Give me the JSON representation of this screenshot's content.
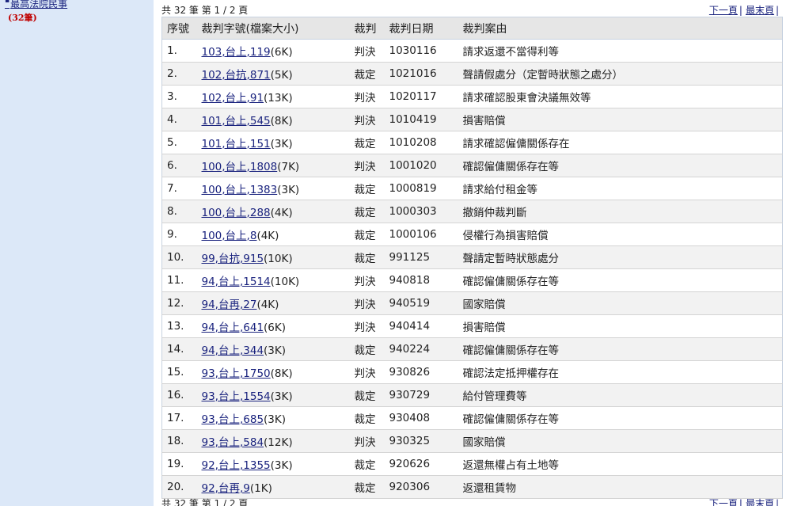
{
  "sidebar": {
    "court_link": "最高法院民事",
    "court_count": "(32筆)"
  },
  "pager": {
    "count_text": "共 32 筆 第 1 / 2 頁",
    "next_label": "下一頁",
    "last_label": "最末頁"
  },
  "table": {
    "headers": {
      "no": "序號",
      "case": "裁判字號(檔案大小)",
      "type": "裁判",
      "date": "裁判日期",
      "reason": "裁判案由"
    },
    "rows": [
      {
        "no": "1.",
        "case": "103,台上,119",
        "size": "(6K)",
        "type": "判決",
        "date": "1030116",
        "reason": "請求返還不當得利等"
      },
      {
        "no": "2.",
        "case": "102,台抗,871",
        "size": "(5K)",
        "type": "裁定",
        "date": "1021016",
        "reason": "聲請假處分（定暫時狀態之處分）"
      },
      {
        "no": "3.",
        "case": "102,台上,91",
        "size": "(13K)",
        "type": "判決",
        "date": "1020117",
        "reason": "請求確認股東會決議無效等"
      },
      {
        "no": "4.",
        "case": "101,台上,545",
        "size": "(8K)",
        "type": "判決",
        "date": "1010419",
        "reason": "損害賠償"
      },
      {
        "no": "5.",
        "case": "101,台上,151",
        "size": "(3K)",
        "type": "裁定",
        "date": "1010208",
        "reason": "請求確認僱傭關係存在"
      },
      {
        "no": "6.",
        "case": "100,台上,1808",
        "size": "(7K)",
        "type": "判決",
        "date": "1001020",
        "reason": "確認僱傭關係存在等"
      },
      {
        "no": "7.",
        "case": "100,台上,1383",
        "size": "(3K)",
        "type": "裁定",
        "date": "1000819",
        "reason": "請求給付租金等"
      },
      {
        "no": "8.",
        "case": "100,台上,288",
        "size": "(4K)",
        "type": "裁定",
        "date": "1000303",
        "reason": "撤銷仲裁判斷"
      },
      {
        "no": "9.",
        "case": "100,台上,8",
        "size": "(4K)",
        "type": "裁定",
        "date": "1000106",
        "reason": "侵權行為損害賠償"
      },
      {
        "no": "10.",
        "case": "99,台抗,915",
        "size": "(10K)",
        "type": "裁定",
        "date": "991125",
        "reason": "聲請定暫時狀態處分"
      },
      {
        "no": "11.",
        "case": "94,台上,1514",
        "size": "(10K)",
        "type": "判決",
        "date": "940818",
        "reason": "確認僱傭關係存在等"
      },
      {
        "no": "12.",
        "case": "94,台再,27",
        "size": "(4K)",
        "type": "判決",
        "date": "940519",
        "reason": "國家賠償"
      },
      {
        "no": "13.",
        "case": "94,台上,641",
        "size": "(6K)",
        "type": "判決",
        "date": "940414",
        "reason": "損害賠償"
      },
      {
        "no": "14.",
        "case": "94,台上,344",
        "size": "(3K)",
        "type": "裁定",
        "date": "940224",
        "reason": "確認僱傭關係存在等"
      },
      {
        "no": "15.",
        "case": "93,台上,1750",
        "size": "(8K)",
        "type": "判決",
        "date": "930826",
        "reason": "確認法定抵押權存在"
      },
      {
        "no": "16.",
        "case": "93,台上,1554",
        "size": "(3K)",
        "type": "裁定",
        "date": "930729",
        "reason": "給付管理費等"
      },
      {
        "no": "17.",
        "case": "93,台上,685",
        "size": "(3K)",
        "type": "裁定",
        "date": "930408",
        "reason": "確認僱傭關係存在等"
      },
      {
        "no": "18.",
        "case": "93,台上,584",
        "size": "(12K)",
        "type": "判決",
        "date": "930325",
        "reason": "國家賠償"
      },
      {
        "no": "19.",
        "case": "92,台上,1355",
        "size": "(3K)",
        "type": "裁定",
        "date": "920626",
        "reason": "返還無權占有土地等"
      },
      {
        "no": "20.",
        "case": "92,台再,9",
        "size": "(1K)",
        "type": "裁定",
        "date": "920306",
        "reason": "返還租賃物"
      }
    ]
  }
}
